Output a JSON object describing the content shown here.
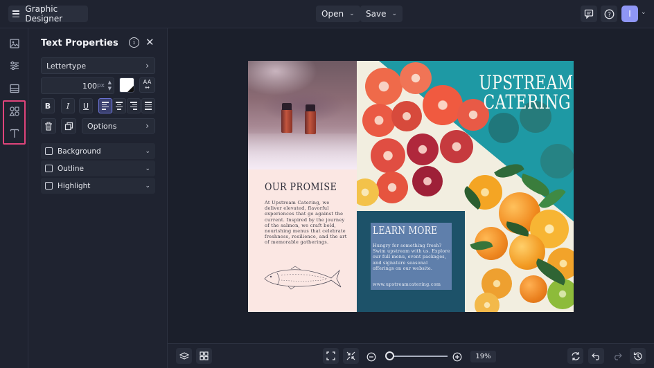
{
  "topbar": {
    "app_title": "Graphic Designer",
    "open_label": "Open",
    "save_label": "Save",
    "avatar_initial": "I"
  },
  "panel": {
    "title": "Text Properties",
    "font_family": "Lettertype",
    "font_size": "100",
    "font_size_unit": "px",
    "options_label": "Options",
    "format_buttons": [
      "B",
      "I",
      "U"
    ],
    "effects": [
      "Background",
      "Outline",
      "Highlight"
    ],
    "text_color": "#ffffff",
    "active_alignment": "left"
  },
  "document": {
    "headline_line1": "UPSTREAM",
    "headline_line2": "CATERING",
    "promise_title": "OUR PROMISE",
    "promise_body": "At Upstream Catering, we deliver elevated, flavorful experiences that go against the current. Inspired by the journey of the salmon, we craft bold, nourishing menus that celebrate freshness, resilience, and the art of memorable gatherings.",
    "learn_title": "LEARN MORE",
    "learn_body": "Hungry for something fresh? Swim upstream with us. Explore our full menu, event packages, and signature seasonal offerings on our website.",
    "learn_url": "www.upstreamcatering.com"
  },
  "bottombar": {
    "zoom": "19%",
    "zoom_fraction": 0.02
  },
  "colors": {
    "accent": "#8f96f5",
    "rail_highlight": "#e0447b",
    "teal": "#1e99a4",
    "navy": "#1d5269"
  },
  "icons": {
    "rail": [
      "image-icon",
      "sliders-icon",
      "layout-icon",
      "shapes-icon",
      "text-icon"
    ],
    "topbar": [
      "comment-icon",
      "help-icon"
    ],
    "bottombar": [
      "layers-icon",
      "grid-icon",
      "fit-screen-icon",
      "shrink-icon",
      "zoom-out-icon",
      "zoom-in-icon",
      "refresh-icon",
      "undo-icon",
      "redo-icon",
      "history-icon"
    ]
  }
}
